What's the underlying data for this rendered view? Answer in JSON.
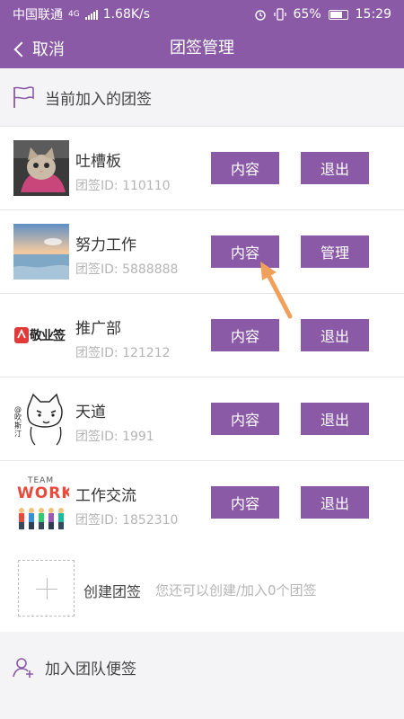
{
  "status_bar": {
    "carrier": "中国联通",
    "network": "4G",
    "speed": "1.68K/s",
    "battery": "65%",
    "time": "15:29"
  },
  "nav": {
    "back_label": "取消",
    "title": "团签管理"
  },
  "current_section": {
    "title": "当前加入的团签",
    "icon": "flag-icon"
  },
  "groups": [
    {
      "name": "吐槽板",
      "id_text": "团签ID: 110110",
      "btn1": "内容",
      "btn2": "退出",
      "avatar": "cat-avatar"
    },
    {
      "name": "努力工作",
      "id_text": "团签ID: 5888888",
      "btn1": "内容",
      "btn2": "管理",
      "avatar": "seaside-sunset-avatar"
    },
    {
      "name": "推广部",
      "id_text": "团签ID: 121212",
      "btn1": "内容",
      "btn2": "退出",
      "avatar": "jingyeqian-logo",
      "logo_text": "敬业签"
    },
    {
      "name": "天道",
      "id_text": "团签ID: 1991",
      "btn1": "内容",
      "btn2": "退出",
      "avatar": "cartoon-cat-avatar",
      "side_text": "@吹斯汀"
    },
    {
      "name": "工作交流",
      "id_text": "团签ID: 1852310",
      "btn1": "内容",
      "btn2": "退出",
      "avatar": "teamwork-avatar",
      "logo_top": "TEAM",
      "logo_word": "WORK"
    }
  ],
  "create": {
    "label": "创建团签",
    "hint": "您还可以创建/加入0个团签"
  },
  "join_section": {
    "title": "加入团队便签",
    "icon": "add-user-icon"
  },
  "colors": {
    "primary": "#8a5aa7",
    "annotation_arrow": "#f0a05a"
  }
}
